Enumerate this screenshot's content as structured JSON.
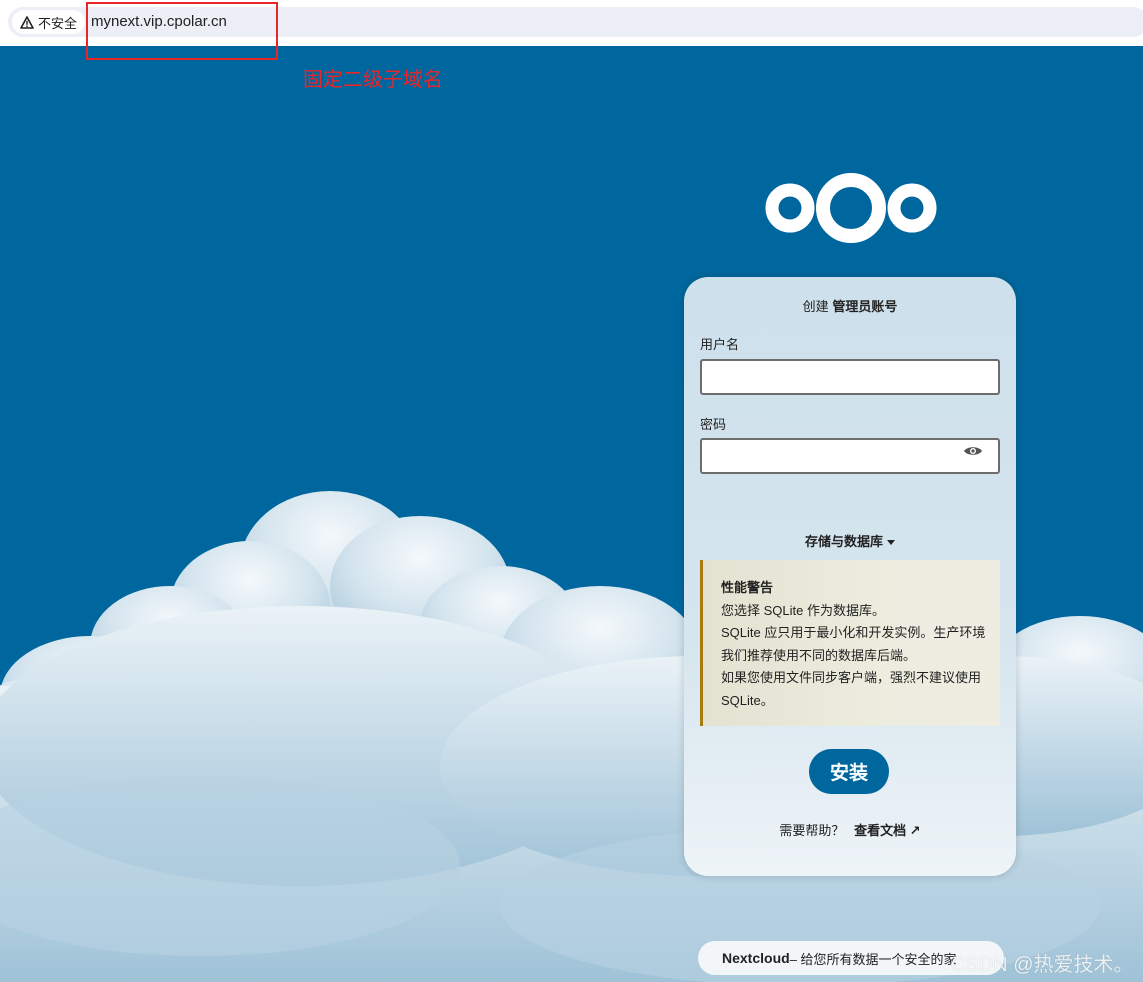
{
  "browser": {
    "security_label": "不安全",
    "url": "mynext.vip.cpolar.cn",
    "security_icon": "warning-triangle-icon"
  },
  "annotation": {
    "text": "固定二级子域名",
    "color": "#e8262a"
  },
  "colors": {
    "background": "#00679e",
    "primary": "#00679e",
    "warning_border": "#a87a10"
  },
  "setup": {
    "title_prefix": "创建",
    "title_bold": "管理员账号",
    "username_label": "用户名",
    "username_value": "",
    "password_label": "密码",
    "password_value": "",
    "storage_label": "存储与数据库",
    "warning": {
      "title": "性能警告",
      "line1": "您选择 SQLite 作为数据库。",
      "line2": "SQLite 应只用于最小化和开发实例。生产环境我们推荐使用不同的数据库后端。",
      "line3": "如果您使用文件同步客户端，强烈不建议使用 SQLite。"
    },
    "install_label": "安装",
    "help_text": "需要帮助？",
    "help_link": "查看文档 ↗"
  },
  "footer": {
    "brand": "Nextcloud",
    "tagline": " – 给您所有数据一个安全的家"
  },
  "watermark": "CSDN @热爱技术。"
}
